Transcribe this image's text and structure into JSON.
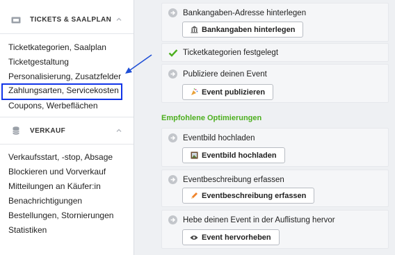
{
  "sidebar": {
    "section1": {
      "title": "TICKETS & SAALPLAN",
      "icon": "ticket-icon",
      "items": [
        {
          "label": "Ticketkategorien, Saalplan"
        },
        {
          "label": "Ticketgestaltung"
        },
        {
          "label": "Personalisierung, Zusatzfelder"
        },
        {
          "label": "Zahlungsarten, Servicekosten",
          "highlighted": true
        },
        {
          "label": "Coupons, Werbeflächen"
        }
      ]
    },
    "section2": {
      "title": "VERKAUF",
      "icon": "database-icon",
      "items": [
        {
          "label": "Verkaufsstart, -stop, Absage"
        },
        {
          "label": "Blockieren und Vorverkauf"
        },
        {
          "label": "Mitteilungen an Käufer:in"
        },
        {
          "label": "Benachrichtigungen"
        },
        {
          "label": "Bestellungen, Stornierungen"
        },
        {
          "label": "Statistiken"
        }
      ]
    }
  },
  "main": {
    "tasks": [
      {
        "text": "Bankangaben-Adresse hinterlegen",
        "button": "Bankangaben hinterlegen",
        "button_icon": "bank-icon",
        "done": false
      },
      {
        "text": "Ticketkategorien festgelegt",
        "done": true
      },
      {
        "text": "Publiziere deinen Event",
        "button": "Event publizieren",
        "button_icon": "party-popper-icon",
        "done": false
      }
    ],
    "recommended_title": "Empfohlene Optimierungen",
    "recommended": [
      {
        "text": "Eventbild hochladen",
        "button": "Eventbild hochladen",
        "button_icon": "picture-icon"
      },
      {
        "text": "Eventbeschreibung erfassen",
        "button": "Eventbeschreibung erfassen",
        "button_icon": "pencil-icon"
      },
      {
        "text": "Hebe deinen Event in der Auflistung hervor",
        "button": "Event hervorheben",
        "button_icon": "eye-icon"
      }
    ]
  },
  "colors": {
    "highlight_border": "#1134e8",
    "green": "#4caf1e",
    "arrow": "#1f4fd6"
  }
}
